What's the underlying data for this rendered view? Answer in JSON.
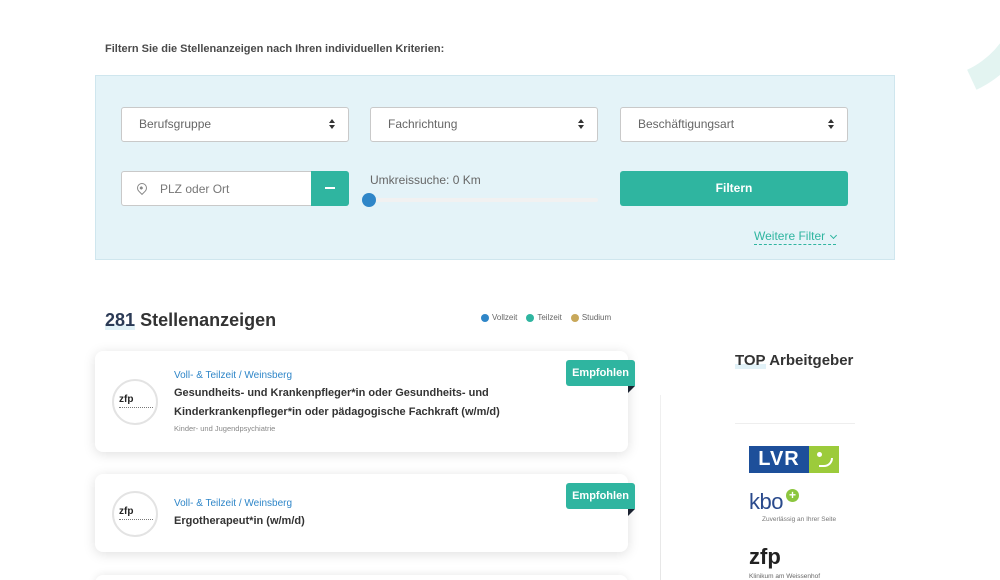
{
  "intro": "Filtern Sie die Stellenanzeigen nach Ihren individuellen Kriterien:",
  "filters": {
    "berufsgruppe": "Berufsgruppe",
    "fachrichtung": "Fachrichtung",
    "beschaeftigungsart": "Beschäftigungsart",
    "location_placeholder": "PLZ oder Ort",
    "radius_label": "Umkreissuche:  0 Km",
    "radius_km": 0,
    "filter_button": "Filtern",
    "more_filters": "Weitere Filter"
  },
  "results": {
    "count": "281",
    "label": "Stellenanzeigen"
  },
  "legend": [
    {
      "label": "Vollzeit",
      "color": "#2f86c8"
    },
    {
      "label": "Teilzeit",
      "color": "#2fb5a0"
    },
    {
      "label": "Studium",
      "color": "#c8a85a"
    }
  ],
  "jobs": [
    {
      "meta": "Voll- & Teilzeit / Weinsberg",
      "title": "Gesundheits- und Krankenpfleger*in oder Gesundheits- und Kinderkrankenpfleger*in oder pädagogische Fachkraft (w/m/d)",
      "subtitle": "Kinder- und Jugendpsychiatrie",
      "badge": "Empfohlen",
      "logo": "zfp"
    },
    {
      "meta": "Voll- & Teilzeit / Weinsberg",
      "title": "Ergotherapeut*in (w/m/d)",
      "subtitle": "",
      "badge": "Empfohlen",
      "logo": "zfp"
    }
  ],
  "sidebar": {
    "heading_bold": "TOP",
    "heading_rest": " Arbeitgeber",
    "employers": [
      {
        "name": "LVR",
        "claim": ""
      },
      {
        "name": "kbo",
        "claim": "Zuverlässig an Ihrer Seite"
      },
      {
        "name": "zfp",
        "claim": "Klinikum am Weissenhof"
      }
    ]
  },
  "colors": {
    "accent": "#2fb5a0",
    "link": "#2f86c8",
    "panel": "#e4f3f8"
  }
}
